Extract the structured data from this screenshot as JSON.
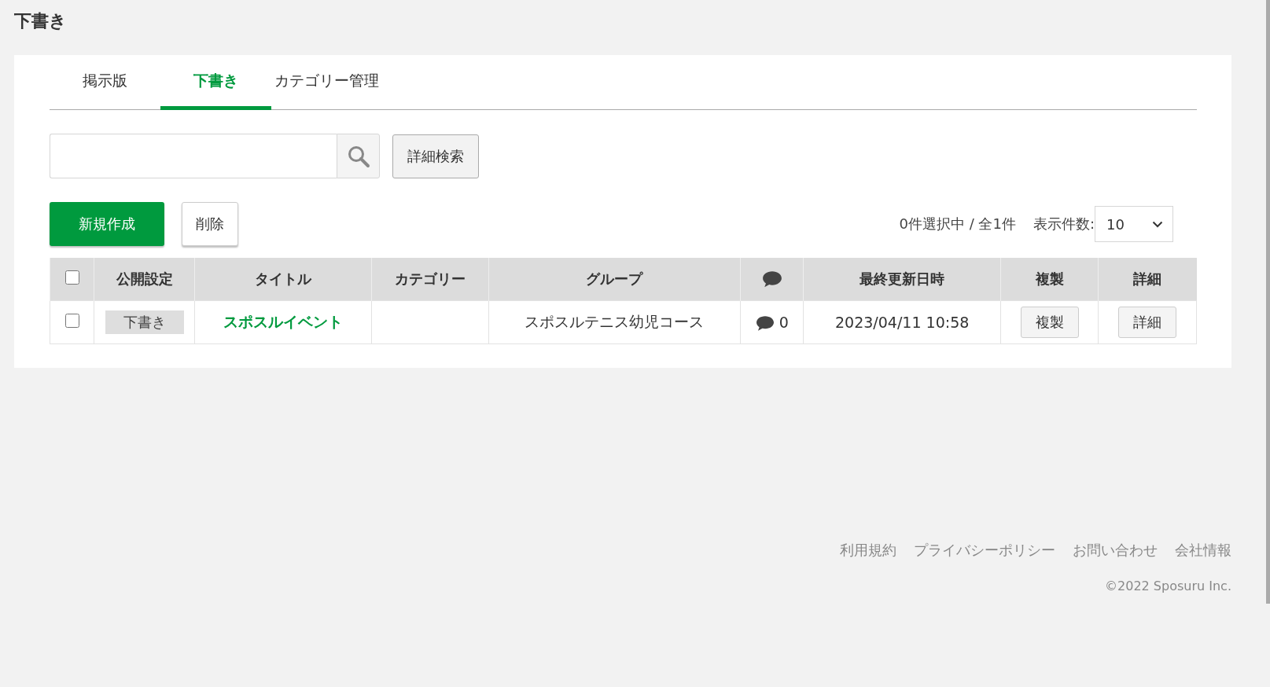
{
  "page_title": "下書き",
  "tabs": [
    {
      "label": "掲示版",
      "selected": false
    },
    {
      "label": "下書き",
      "selected": true
    },
    {
      "label": "カテゴリー管理",
      "selected": false
    }
  ],
  "search": {
    "advanced_button": "詳細検索"
  },
  "actions": {
    "create_button": "新規作成",
    "delete_button": "削除"
  },
  "selection_status": "0件選択中 / 全1件",
  "page_size": {
    "label": "表示件数:",
    "value": "10"
  },
  "table": {
    "select_all_checked": false,
    "columns": [
      {
        "kind": "checkbox"
      },
      {
        "kind": "text",
        "label": "公開設定"
      },
      {
        "kind": "text",
        "label": "タイトル"
      },
      {
        "kind": "text",
        "label": "カテゴリー"
      },
      {
        "kind": "text",
        "label": "グループ"
      },
      {
        "kind": "comment_icon"
      },
      {
        "kind": "text",
        "label": "最終更新日時"
      },
      {
        "kind": "text",
        "label": "複製"
      },
      {
        "kind": "text",
        "label": "詳細"
      }
    ],
    "rows": [
      {
        "checked": false,
        "status": "下書き",
        "title": "スポスルイベント",
        "group": "スポスルテニス幼児コース",
        "comments": "0",
        "updated": "2023/04/11 10:58",
        "copy_button": "複製",
        "detail_button": "詳細"
      }
    ]
  },
  "footer": {
    "links": [
      "利用規約",
      "プライバシーポリシー",
      "お問い合わせ",
      "会社情報"
    ],
    "copyright": "©2022 Sposuru Inc."
  }
}
